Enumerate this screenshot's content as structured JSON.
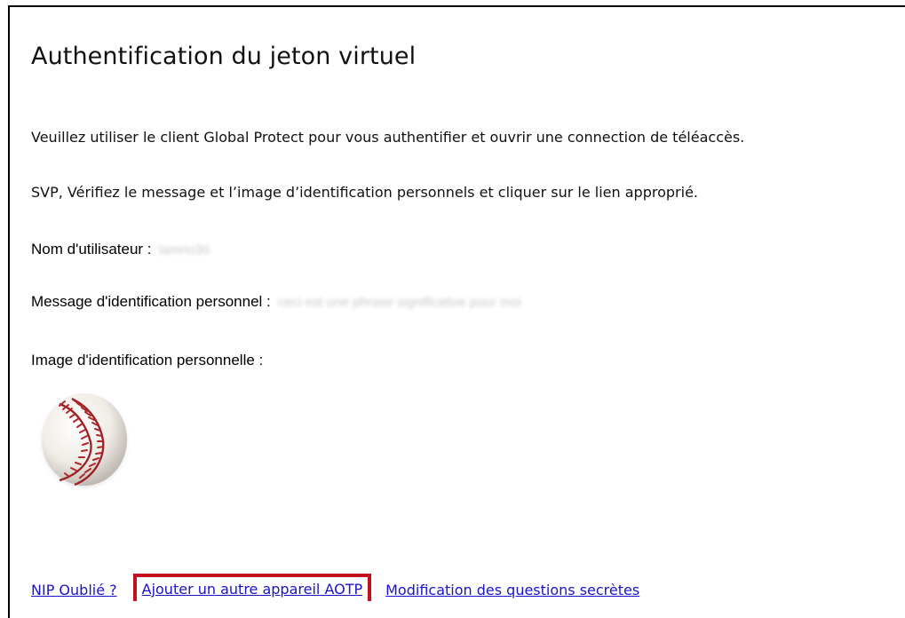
{
  "page": {
    "title": "Authentification du jeton virtuel",
    "instructions": [
      "Veuillez utiliser le client Global Protect pour vous authentifier et ouvrir une connection de téléaccès.",
      "SVP, Vérifiez le message et l’image d’identification personnels et cliquer sur le lien approprié."
    ]
  },
  "details": {
    "username_label": "Nom d'utilisateur :",
    "username_value": "lamrio30",
    "message_label": "Message d'identification personnel :",
    "message_value": "ceci est une phrase significative pour moi",
    "image_label": "Image d'identification personnelle :",
    "image_icon": "baseball-image"
  },
  "links": {
    "forgot_pin": "NIP Oublié ?",
    "add_aotp": "Ajouter un autre appareil AOTP",
    "modify_questions": "Modification des questions secrètes"
  },
  "colors": {
    "link": "#1a13c9",
    "highlight": "#c1121f",
    "border": "#000000"
  }
}
